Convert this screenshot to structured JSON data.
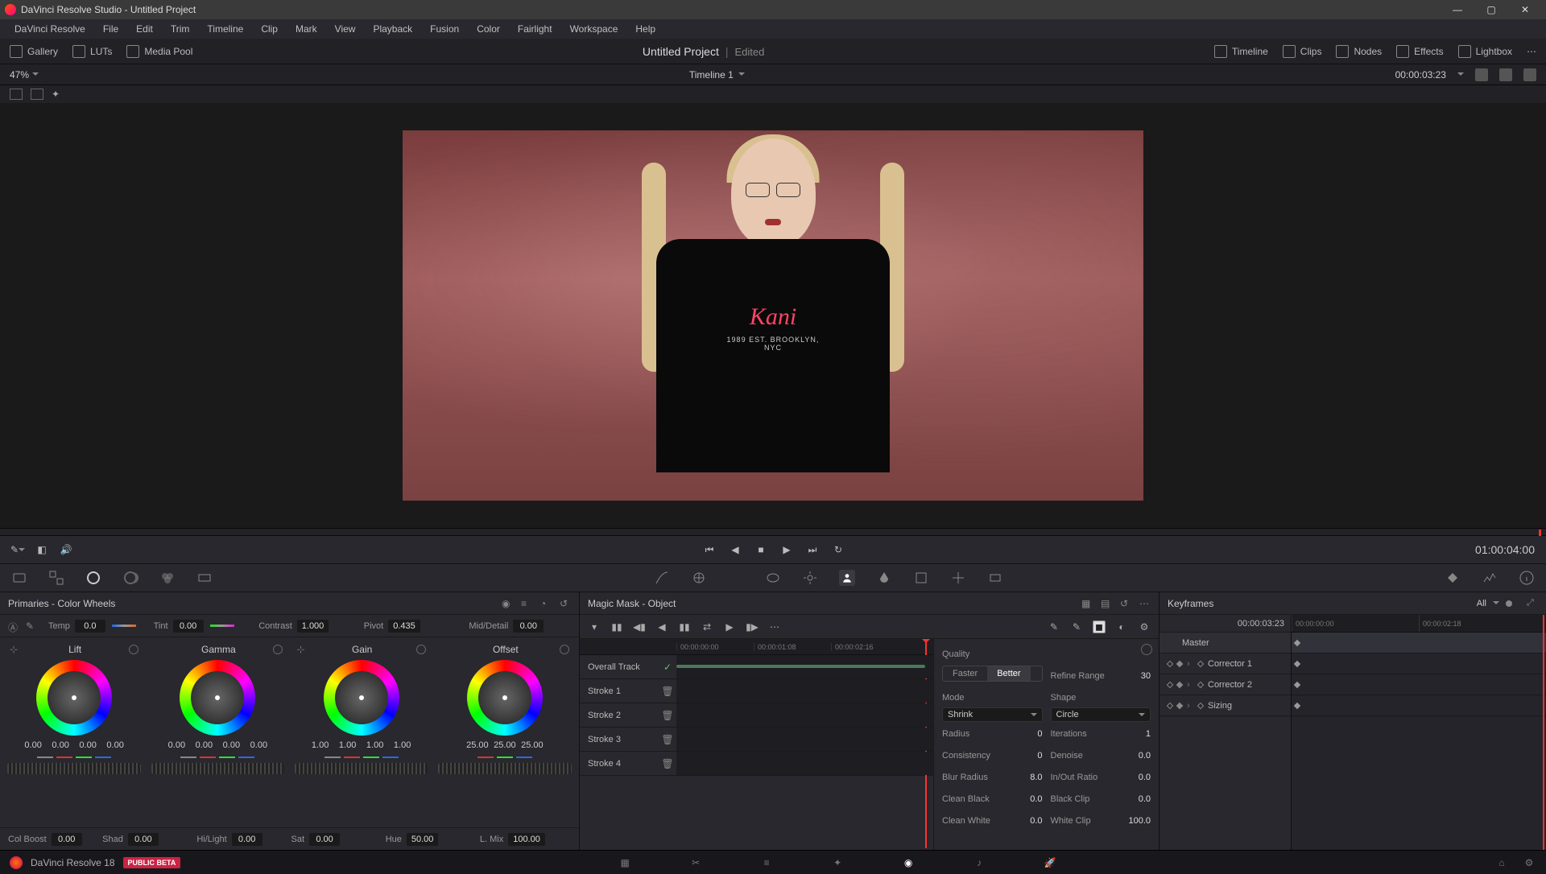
{
  "window": {
    "title": "DaVinci Resolve Studio - Untitled Project"
  },
  "menu": [
    "DaVinci Resolve",
    "File",
    "Edit",
    "Trim",
    "Timeline",
    "Clip",
    "Mark",
    "View",
    "Playback",
    "Fusion",
    "Color",
    "Fairlight",
    "Workspace",
    "Help"
  ],
  "toolbar": {
    "gallery": "Gallery",
    "luts": "LUTs",
    "mediapool": "Media Pool",
    "project": "Untitled Project",
    "edited": "Edited",
    "timeline": "Timeline",
    "clips": "Clips",
    "nodes": "Nodes",
    "effects": "Effects",
    "lightbox": "Lightbox"
  },
  "viewer": {
    "zoom": "47%",
    "timeline_name": "Timeline 1",
    "timecode": "00:00:03:23",
    "shirt_logo": "Kani",
    "shirt_sub": "1989 EST. BROOKLYN, NYC"
  },
  "transport": {
    "record_tc": "01:00:04:00"
  },
  "primaries": {
    "title": "Primaries - Color Wheels",
    "adjust1": {
      "temp": {
        "label": "Temp",
        "val": "0.0"
      },
      "tint": {
        "label": "Tint",
        "val": "0.00"
      },
      "contrast": {
        "label": "Contrast",
        "val": "1.000"
      },
      "pivot": {
        "label": "Pivot",
        "val": "0.435"
      },
      "middetail": {
        "label": "Mid/Detail",
        "val": "0.00"
      }
    },
    "wheels": {
      "lift": {
        "name": "Lift",
        "vals": [
          "0.00",
          "0.00",
          "0.00",
          "0.00"
        ]
      },
      "gamma": {
        "name": "Gamma",
        "vals": [
          "0.00",
          "0.00",
          "0.00",
          "0.00"
        ]
      },
      "gain": {
        "name": "Gain",
        "vals": [
          "1.00",
          "1.00",
          "1.00",
          "1.00"
        ]
      },
      "offset": {
        "name": "Offset",
        "vals": [
          "25.00",
          "25.00",
          "25.00"
        ]
      }
    },
    "adjust2": {
      "colboost": {
        "label": "Col Boost",
        "val": "0.00"
      },
      "shad": {
        "label": "Shad",
        "val": "0.00"
      },
      "hilight": {
        "label": "Hi/Light",
        "val": "0.00"
      },
      "sat": {
        "label": "Sat",
        "val": "0.00"
      },
      "hue": {
        "label": "Hue",
        "val": "50.00"
      },
      "lmix": {
        "label": "L. Mix",
        "val": "100.00"
      }
    }
  },
  "magicmask": {
    "title": "Magic Mask - Object",
    "ruler": [
      "00:00:00:00",
      "00:00:01:08",
      "00:00:02:16"
    ],
    "tracks": {
      "overall": "Overall Track",
      "s1": "Stroke 1",
      "s2": "Stroke 2",
      "s3": "Stroke 3",
      "s4": "Stroke 4"
    },
    "quality": {
      "label": "Quality",
      "faster": "Faster",
      "better": "Better",
      "refine": "Refine Range",
      "refine_val": "30"
    },
    "mode": {
      "label": "Mode",
      "val": "Shrink"
    },
    "shape": {
      "label": "Shape",
      "val": "Circle"
    },
    "radius": {
      "label": "Radius",
      "val": "0"
    },
    "iterations": {
      "label": "Iterations",
      "val": "1"
    },
    "consistency": {
      "label": "Consistency",
      "val": "0"
    },
    "denoise": {
      "label": "Denoise",
      "val": "0.0"
    },
    "blurradius": {
      "label": "Blur Radius",
      "val": "8.0"
    },
    "inout": {
      "label": "In/Out Ratio",
      "val": "0.0"
    },
    "cleanblack": {
      "label": "Clean Black",
      "val": "0.0"
    },
    "blackclip": {
      "label": "Black Clip",
      "val": "0.0"
    },
    "cleanwhite": {
      "label": "Clean White",
      "val": "0.0"
    },
    "whiteclip": {
      "label": "White Clip",
      "val": "100.0"
    }
  },
  "keyframes": {
    "title": "Keyframes",
    "all": "All",
    "tc": "00:00:03:23",
    "ruler": [
      "00:00:00:00",
      "00:00:02:18"
    ],
    "master": "Master",
    "nodes": [
      "Corrector 1",
      "Corrector 2",
      "Sizing"
    ]
  },
  "bottombar": {
    "app": "DaVinci Resolve 18",
    "badge": "PUBLIC BETA"
  }
}
